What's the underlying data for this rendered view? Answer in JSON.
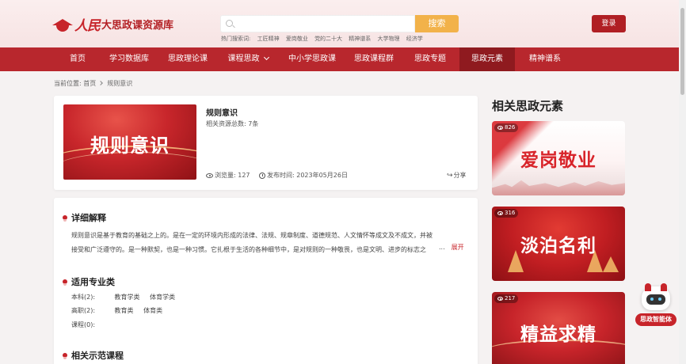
{
  "header": {
    "logo_brand": "人民",
    "logo_text": "大思政课资源库",
    "search_placeholder": "",
    "search_button": "搜索",
    "hot_label": "热门搜索词:",
    "hot_words": [
      "工匠精神",
      "爱岗敬业",
      "党的二十大",
      "精神谱系",
      "大学物理",
      "经济学"
    ],
    "login": "登录"
  },
  "nav": {
    "items": [
      {
        "label": "首页"
      },
      {
        "label": "学习数据库"
      },
      {
        "label": "思政理论课"
      },
      {
        "label": "课程思政"
      },
      {
        "label": "中小学思政课"
      },
      {
        "label": "思政课程群"
      },
      {
        "label": "思政专题"
      },
      {
        "label": "思政元素"
      },
      {
        "label": "精神谱系"
      }
    ]
  },
  "breadcrumb": {
    "prefix": "当前位置:",
    "home": "首页",
    "current": "规则意识"
  },
  "main_card": {
    "cover_title": "规则意识",
    "title": "规则意识",
    "resource_count": "相关资源总数: 7条",
    "views": "浏览量: 127",
    "publish_time": "发布时间: 2023年05月26日",
    "share": "分享"
  },
  "detail": {
    "explain_title": "详细解释",
    "explain_text": "规则意识是基于教育的基础之上的。是在一定的环境内形成的法律、法规、规章制度、道德规范、人文情怀等成文及不成文，并被接受和广泛遵守的。是一种默契，也是一种习惯。它扎根于生活的各种细节中，是对规则的一种敬畏，也是文明、进步的标志之",
    "ellipsis": "...",
    "more": "展开",
    "major_title": "适用专业类",
    "majors": [
      {
        "level": "本科(2):",
        "tags": [
          "教育学类",
          "体育学类"
        ]
      },
      {
        "level": "高职(2):",
        "tags": [
          "教育类",
          "体育类"
        ]
      },
      {
        "level": "课程(0):",
        "tags": []
      }
    ],
    "courses_title": "相关示范课程"
  },
  "sidebar": {
    "title": "相关思政元素",
    "cards": [
      {
        "name": "爱岗敬业",
        "views": "826"
      },
      {
        "name": "淡泊名利",
        "views": "316"
      },
      {
        "name": "精益求精",
        "views": "217"
      }
    ]
  },
  "assistant": {
    "label": "思政智能体"
  }
}
